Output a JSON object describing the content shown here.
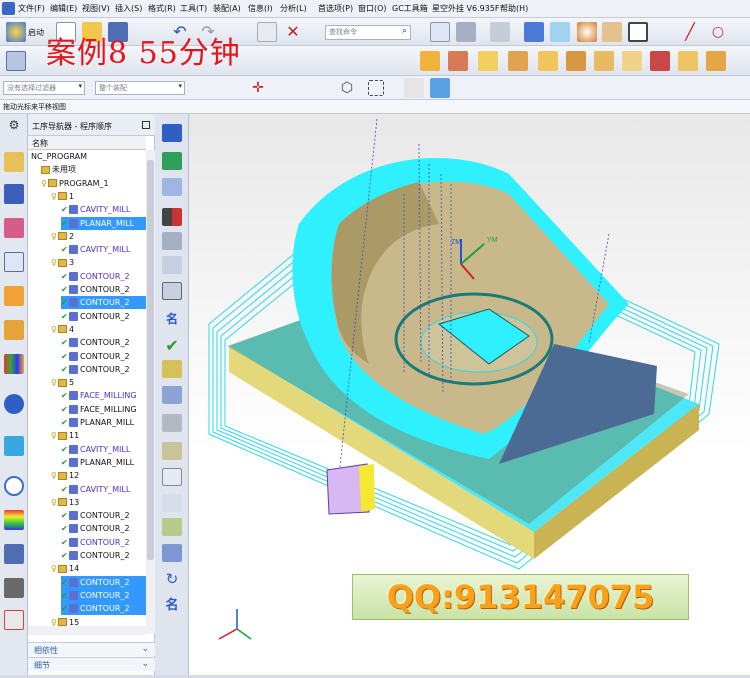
{
  "menubar": {
    "items": [
      "文件(F)",
      "编辑(E)",
      "视图(V)",
      "插入(S)",
      "格式(R)",
      "工具(T)",
      "装配(A)",
      "信息(I)",
      "分析(L)",
      "首选项(P)",
      "窗口(O)",
      "GC工具箱",
      "星空外挂 V6.935F",
      "帮助(H)"
    ]
  },
  "toolbar1": {
    "start_label": "启动",
    "command_search_placeholder": "查找命令"
  },
  "overlay": {
    "title": "案例8 55分钟",
    "qq_banner": "QQ:913147075"
  },
  "toolbar3": {
    "filter_placeholder": "没有选择过滤器",
    "assembly_placeholder": "整个装配"
  },
  "status": {
    "hint": "拖动光标来平移视图"
  },
  "navigator": {
    "title": "工序导航器 - 程序顺序",
    "column_name": "名称",
    "rows": [
      {
        "indent": 0,
        "label": "NC_PROGRAM",
        "kind": "root",
        "sel": false
      },
      {
        "indent": 1,
        "label": "未用项",
        "kind": "folder",
        "sel": false
      },
      {
        "indent": 1,
        "label": "PROGRAM_1",
        "kind": "program",
        "sel": false
      },
      {
        "indent": 2,
        "label": "1",
        "kind": "group",
        "sel": false
      },
      {
        "indent": 3,
        "label": "CAVITY_MILL",
        "kind": "op",
        "sel": false
      },
      {
        "indent": 3,
        "label": "PLANAR_MILL",
        "kind": "op",
        "sel": true
      },
      {
        "indent": 2,
        "label": "2",
        "kind": "group",
        "sel": false
      },
      {
        "indent": 3,
        "label": "CAVITY_MILL",
        "kind": "op",
        "sel": false
      },
      {
        "indent": 2,
        "label": "3",
        "kind": "group",
        "sel": false
      },
      {
        "indent": 3,
        "label": "CONTOUR_2",
        "kind": "op",
        "sel": false
      },
      {
        "indent": 3,
        "label": "CONTOUR_2",
        "kind": "op",
        "sel": false
      },
      {
        "indent": 3,
        "label": "CONTOUR_2",
        "kind": "op",
        "sel": true
      },
      {
        "indent": 3,
        "label": "CONTOUR_2",
        "kind": "op",
        "sel": false
      },
      {
        "indent": 2,
        "label": "4",
        "kind": "group",
        "sel": false
      },
      {
        "indent": 3,
        "label": "CONTOUR_2",
        "kind": "op",
        "sel": false
      },
      {
        "indent": 3,
        "label": "CONTOUR_2",
        "kind": "op",
        "sel": false
      },
      {
        "indent": 3,
        "label": "CONTOUR_2",
        "kind": "op",
        "sel": false
      },
      {
        "indent": 2,
        "label": "5",
        "kind": "group",
        "sel": false
      },
      {
        "indent": 3,
        "label": "FACE_MILLING",
        "kind": "op",
        "sel": false
      },
      {
        "indent": 3,
        "label": "FACE_MILLING",
        "kind": "op",
        "sel": false
      },
      {
        "indent": 3,
        "label": "PLANAR_MILL",
        "kind": "op",
        "sel": false
      },
      {
        "indent": 2,
        "label": "11",
        "kind": "group",
        "sel": false
      },
      {
        "indent": 3,
        "label": "CAVITY_MILL",
        "kind": "op",
        "sel": false
      },
      {
        "indent": 3,
        "label": "PLANAR_MILL",
        "kind": "op",
        "sel": false
      },
      {
        "indent": 2,
        "label": "12",
        "kind": "group",
        "sel": false
      },
      {
        "indent": 3,
        "label": "CAVITY_MILL",
        "kind": "op",
        "sel": false
      },
      {
        "indent": 2,
        "label": "13",
        "kind": "group",
        "sel": false
      },
      {
        "indent": 3,
        "label": "CONTOUR_2",
        "kind": "op",
        "sel": false
      },
      {
        "indent": 3,
        "label": "CONTOUR_2",
        "kind": "op",
        "sel": false
      },
      {
        "indent": 3,
        "label": "CONTOUR_2",
        "kind": "op",
        "sel": false
      },
      {
        "indent": 3,
        "label": "CONTOUR_2",
        "kind": "op",
        "sel": false
      },
      {
        "indent": 2,
        "label": "14",
        "kind": "group",
        "sel": false
      },
      {
        "indent": 3,
        "label": "CONTOUR_2",
        "kind": "op",
        "sel": true
      },
      {
        "indent": 3,
        "label": "CONTOUR_2",
        "kind": "op",
        "sel": true
      },
      {
        "indent": 3,
        "label": "CONTOUR_2",
        "kind": "op",
        "sel": true
      },
      {
        "indent": 2,
        "label": "15",
        "kind": "group",
        "sel": false
      }
    ],
    "panel_dependencies": "相依性",
    "panel_details": "细节"
  },
  "viewport": {
    "axis_labels": {
      "zm": "ZM",
      "ym": "YM",
      "xm": "XM"
    }
  }
}
